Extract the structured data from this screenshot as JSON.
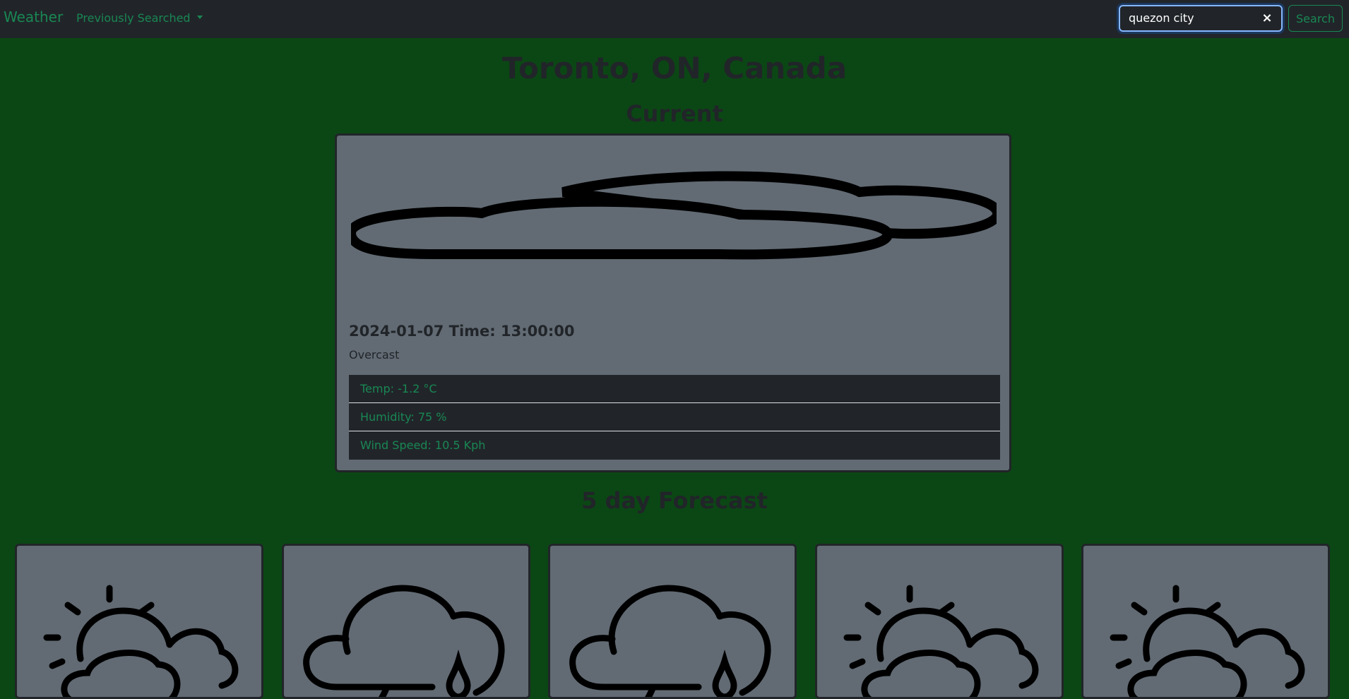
{
  "navbar": {
    "brand": "Weather",
    "dropdown_label": "Previously Searched",
    "search_value": "quezon city",
    "clear_symbol": "×",
    "search_button": "Search"
  },
  "location": "Toronto, ON, Canada",
  "current": {
    "heading": "Current",
    "icon": "overcast-clouds-icon",
    "date_line": "2024-01-07 Time: 13:00:00",
    "condition": "Overcast",
    "temp": "Temp: -1.2 °C",
    "humidity": "Humidity: 75 %",
    "wind": "Wind Speed: 10.5 Kph"
  },
  "forecast": {
    "heading": "5 day Forecast",
    "days": [
      {
        "icon": "partly-cloudy-icon"
      },
      {
        "icon": "rain-cloud-icon"
      },
      {
        "icon": "rain-cloud-icon"
      },
      {
        "icon": "partly-cloudy-icon"
      },
      {
        "icon": "partly-cloudy-icon"
      }
    ]
  },
  "colors": {
    "page_background": "#0b4714",
    "navbar": "#212529",
    "accent_green": "#198754",
    "card_background": "#626b74",
    "text_dark": "#212529",
    "focus_border": "#86b7fe"
  }
}
